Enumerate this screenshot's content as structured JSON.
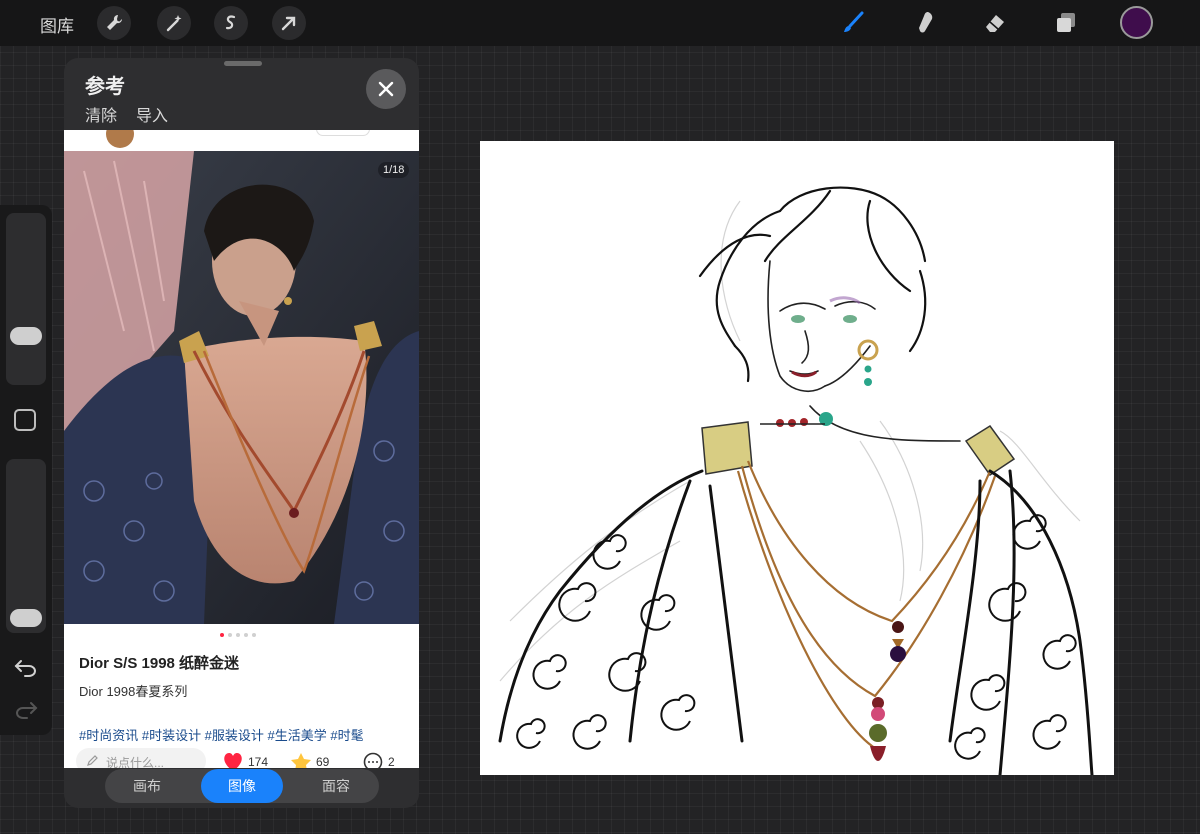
{
  "toolbar": {
    "gallery_label": "图库",
    "icons": [
      "wrench-icon",
      "magic-wand-icon",
      "selection-icon",
      "transform-arrow-icon"
    ],
    "right_icons": [
      "brush-icon",
      "smudge-icon",
      "eraser-icon",
      "layers-icon"
    ],
    "active_color": "#3f0d4c",
    "brush_accent": "#1a82fb"
  },
  "reference_panel": {
    "title": "参考",
    "clear_label": "清除",
    "import_label": "导入",
    "post": {
      "image_counter": "1/18",
      "title": "Dior S/S 1998 纸醉金迷",
      "description": "Dior 1998春夏系列",
      "tags": "#时尚资讯 #时装设计 #服装设计 #生活美学 #时髦",
      "comment_placeholder": "说点什么...",
      "likes": "174",
      "favorites": "69",
      "comments": "2"
    },
    "tabs": [
      {
        "label": "画布"
      },
      {
        "label": "图像"
      },
      {
        "label": "面容"
      }
    ],
    "active_tab": "图像"
  }
}
